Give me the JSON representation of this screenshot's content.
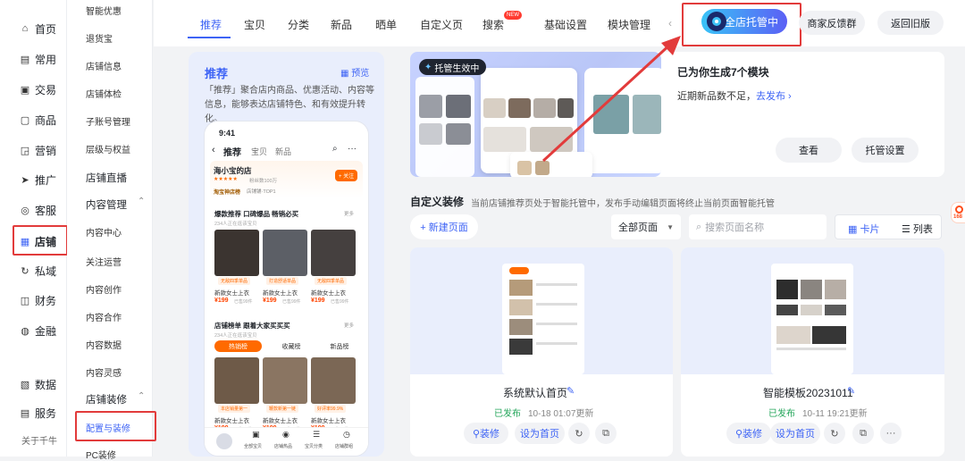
{
  "sidebar": {
    "items": [
      {
        "icon": "home-icon",
        "glyph": "⌂",
        "label": "首页"
      },
      {
        "icon": "common-icon",
        "glyph": "▤",
        "label": "常用"
      },
      {
        "icon": "trade-icon",
        "glyph": "▣",
        "label": "交易"
      },
      {
        "icon": "goods-icon",
        "glyph": "▢",
        "label": "商品"
      },
      {
        "icon": "marketing-icon",
        "glyph": "◲",
        "label": "营销"
      },
      {
        "icon": "promotion-icon",
        "glyph": "➤",
        "label": "推广"
      },
      {
        "icon": "service-icon",
        "glyph": "◎",
        "label": "客服"
      },
      {
        "icon": "shop-icon",
        "glyph": "▦",
        "label": "店铺"
      },
      {
        "icon": "private-icon",
        "glyph": "↻",
        "label": "私域"
      },
      {
        "icon": "finance-icon",
        "glyph": "◫",
        "label": "财务"
      },
      {
        "icon": "finance2-icon",
        "glyph": "◍",
        "label": "金融"
      },
      {
        "icon": "data-icon",
        "glyph": "▧",
        "label": "数据"
      },
      {
        "icon": "service2-icon",
        "glyph": "▤",
        "label": "服务"
      }
    ],
    "footer": "关于千牛"
  },
  "subnav": {
    "items": [
      "智能优惠",
      "退货宝",
      "店铺信息",
      "店铺体检",
      "子账号管理",
      "层级与权益"
    ],
    "group1": "店铺直播",
    "group2": "内容管理",
    "group2_items": [
      "内容中心",
      "关注运营",
      "内容创作",
      "内容合作",
      "内容数据",
      "内容灵感"
    ],
    "group3": "店铺装修",
    "group3_items": [
      "配置与装修",
      "PC装修"
    ]
  },
  "tabs": [
    "推荐",
    "宝贝",
    "分类",
    "新品",
    "晒单",
    "自定义页",
    "搜索",
    "基础设置",
    "模块管理"
  ],
  "new_badge": "NEW",
  "tab_more": "‹",
  "top_buttons": {
    "hosting": "全店托管中",
    "feedback": "商家反馈群",
    "back": "返回旧版"
  },
  "preview": {
    "title": "推荐",
    "preview_link": "预览",
    "desc": "「推荐」聚合店内商品、优惠活动、内容等信息，能够表达店铺特色、和有效提升转化。",
    "phone": {
      "time": "9:41",
      "tabs": [
        "推荐",
        "宝贝",
        "新品"
      ],
      "shop_name": "海小宝的店",
      "shop_sub": "粉丝数100万",
      "follow": "+ 关注",
      "shop_tag": "淘宝神店榜",
      "shop_tag2": "店铺铺·TOP1",
      "sec1_title": "爆款推荐  口碑爆品 畅销必买",
      "sec1_more": "更多",
      "sec1_sub": "234人正在逛该宝贝",
      "products": [
        {
          "badge": "无敌四季单品",
          "name": "新款女士上衣",
          "price": "¥199",
          "sold": "已售99件"
        },
        {
          "badge": "打造舒适单品",
          "name": "新款女士上衣",
          "price": "¥199",
          "sold": "已售99件"
        },
        {
          "badge": "无敌四季单品",
          "name": "新款女士上衣",
          "price": "¥199",
          "sold": "已售99件"
        }
      ],
      "sec2_title": "店铺榜单  跟着大家买买买",
      "sec2_more": "更多",
      "sec2_sub": "234人正在逛该宝贝",
      "rank_tabs": [
        "热销榜",
        "收藏榜",
        "新品榜"
      ],
      "products2": [
        {
          "badge": "本店销量第一",
          "name": "新款女士上衣",
          "price": "¥199",
          "sold": "已售99件"
        },
        {
          "badge": "鞭款新第一链",
          "name": "新款女士上衣",
          "price": "¥199",
          "sold": "已售99件"
        },
        {
          "badge": "好评率99.9%",
          "name": "新款女士上衣",
          "price": "¥199",
          "sold": "已售99件"
        }
      ],
      "bottom_nav": [
        "全部宝贝",
        "店铺热品",
        "宝贝分类",
        "店铺群组"
      ]
    }
  },
  "hosting_card": {
    "badge": "托管生效中",
    "title": "已为你生成7个模块",
    "subtitle": "近期新品数不足，",
    "link": "去发布 ›",
    "view": "查看",
    "settings": "托管设置"
  },
  "custom": {
    "title": "自定义装修",
    "desc": "当前店铺推荐页处于智能托管中，发布手动编辑页面将终止当前页面智能托管",
    "new_page": "+ 新建页面",
    "filter": "全部页面",
    "search_placeholder": "搜索页面名称",
    "view_card": "卡片",
    "view_list": "列表"
  },
  "templates": [
    {
      "name": "系统默认首页",
      "status": "已发布",
      "time": "10-18 01:07更新",
      "decorate": "装修",
      "set_home": "设为首页"
    },
    {
      "name": "智能模板20231011",
      "status": "已发布",
      "time": "10-11 19:21更新",
      "decorate": "装修",
      "set_home": "设为首页",
      "more": "···"
    }
  ],
  "edge_tag": "168",
  "colors": {
    "primary": "#3d63f5",
    "red": "#e23b3b",
    "orange": "#ff6a00",
    "green": "#23a55a",
    "bg": "#f2f3f5"
  }
}
